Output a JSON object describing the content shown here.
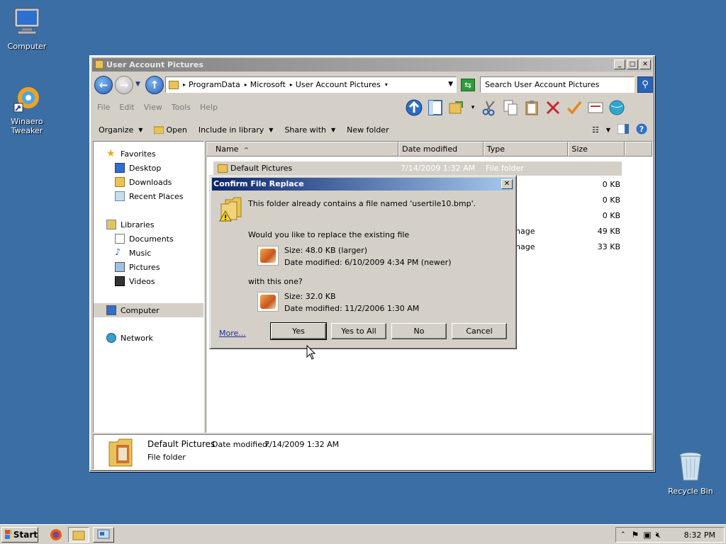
{
  "desktop": {
    "icons": [
      {
        "label": "Computer"
      },
      {
        "label": "Winaero\nTweaker"
      },
      {
        "label": "Recycle Bin"
      }
    ]
  },
  "window": {
    "title": "User Account Pictures",
    "controls": {
      "minimize": "_",
      "maximize": "□",
      "close": "✕"
    },
    "address": {
      "crumbs": [
        "ProgramData",
        "Microsoft",
        "User Account Pictures"
      ]
    },
    "search": {
      "placeholder": "Search User Account Pictures"
    },
    "menu": [
      "File",
      "Edit",
      "View",
      "Tools",
      "Help"
    ],
    "commands": {
      "organize": "Organize",
      "open": "Open",
      "include_in_library": "Include in library",
      "share_with": "Share with",
      "new_folder": "New folder"
    },
    "nav_pane": {
      "favorites": "Favorites",
      "desktop": "Desktop",
      "downloads": "Downloads",
      "recent_places": "Recent Places",
      "libraries": "Libraries",
      "documents": "Documents",
      "music": "Music",
      "pictures": "Pictures",
      "videos": "Videos",
      "computer": "Computer",
      "network": "Network"
    },
    "columns": {
      "name": "Name",
      "date_modified": "Date modified",
      "type": "Type",
      "size": "Size"
    },
    "files": [
      {
        "name": "Default Pictures",
        "date": "7/14/2009 1:32 AM",
        "type": "File folder",
        "size": ""
      },
      {
        "name": "",
        "date": "",
        "type": "",
        "size": "0 KB"
      },
      {
        "name": "",
        "date": "",
        "type": "",
        "size": "0 KB"
      },
      {
        "name": "",
        "date": "",
        "type": "",
        "size": "0 KB"
      },
      {
        "name": "",
        "date": "",
        "type": "nage",
        "size": "49 KB"
      },
      {
        "name": "",
        "date": "",
        "type": "nage",
        "size": "33 KB"
      }
    ],
    "details": {
      "name": "Default Pictures",
      "date_label": "Date modified:",
      "date_value": "7/14/2009 1:32 AM",
      "type": "File folder"
    }
  },
  "dialog": {
    "title": "Confirm File Replace",
    "close": "✕",
    "message": "This folder already contains a file named 'usertile10.bmp'.",
    "question": "Would you like to replace the existing file",
    "existing_size": "Size: 48.0 KB (larger)",
    "existing_date": "Date modified: 6/10/2009 4:34 PM (newer)",
    "with_label": "with this one?",
    "new_size": "Size: 32.0 KB",
    "new_date": "Date modified: 11/2/2006 1:30 AM",
    "more": "More...",
    "buttons": {
      "yes": "Yes",
      "yes_to_all": "Yes to All",
      "no": "No",
      "cancel": "Cancel"
    }
  },
  "taskbar": {
    "start": "Start",
    "clock": "8:32 PM"
  },
  "colors": {
    "desktop": "#3a6ea5",
    "dialog_title_start": "#0a246a",
    "dialog_title_end": "#a6caf0",
    "window_face": "#d4d0c8"
  }
}
